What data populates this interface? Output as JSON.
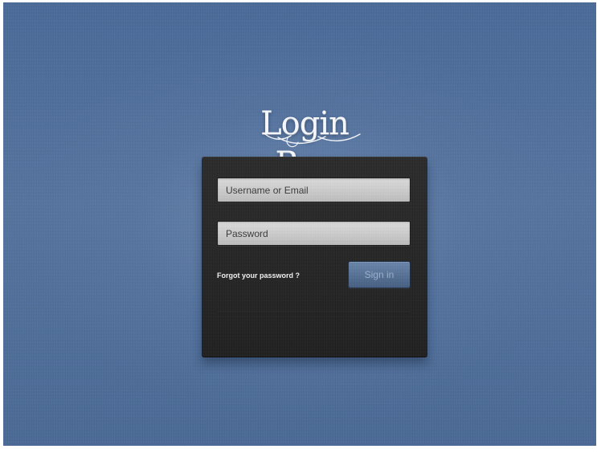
{
  "app": {
    "title": "Login Box"
  },
  "login_form": {
    "username_placeholder": "Username or Email",
    "password_placeholder": "Password",
    "forgot_password_label": "Forgot your password ?",
    "sign_in_label": "Sign in"
  },
  "icons": {
    "logo": "login-box-logo",
    "flourish": "script-flourish"
  },
  "colors": {
    "background_blue": "#4b6a98",
    "panel_dark": "#222222",
    "input_gray": "#c8c8c8",
    "button_blue": "#56729a",
    "button_text": "#9bb0cf"
  }
}
